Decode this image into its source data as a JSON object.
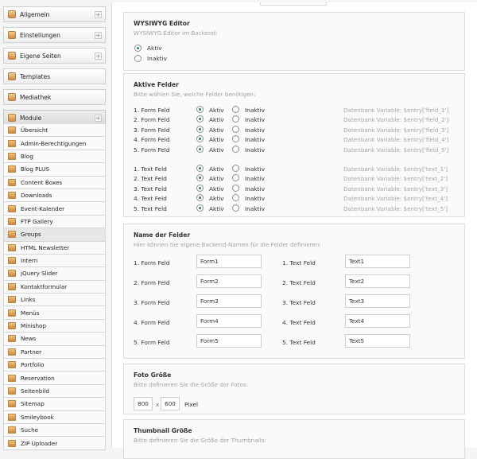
{
  "sidebar": {
    "top": [
      {
        "label": "Allgemein",
        "icon": "gear-icon"
      },
      {
        "label": "Einstellungen",
        "icon": "settings-icon"
      },
      {
        "label": "Eigene Seiten",
        "icon": "pages-icon"
      },
      {
        "label": "Templates",
        "icon": "templates-icon"
      },
      {
        "label": "Mediathek",
        "icon": "media-icon"
      }
    ],
    "module_header": "Module",
    "modules": [
      "Übersicht",
      "Admin-Berechtigungen",
      "Blog",
      "Blog PLUS",
      "Content Boxes",
      "Downloads",
      "Event-Kalender",
      "FTP Gallery",
      "Groups",
      "HTML Newsletter",
      "Intern",
      "jQuery Slider",
      "Kontaktformular",
      "Links",
      "Menüs",
      "Minishop",
      "News",
      "Partner",
      "Portfolio",
      "Reservation",
      "Seitenbild",
      "Sitemap",
      "Smileybook",
      "Suche",
      "ZIP Uploader"
    ],
    "highlighted_index": 8
  },
  "wysiwyg": {
    "title": "WYSIWYG Editor",
    "subtitle": "WYSIWYG Editor im Backend:",
    "opt_active": "Aktiv",
    "opt_inactive": "Inaktiv",
    "selected": "Aktiv"
  },
  "fields": {
    "title": "Aktive Felder",
    "subtitle": "Bitte wählen Sie, welche Felder benötigen:",
    "active_label": "Aktiv",
    "inactive_label": "Inaktiv",
    "form_rows": [
      {
        "label": "1. Form Feld",
        "db": "Datenbank Variable: $entry['field_1']",
        "active": true
      },
      {
        "label": "2. Form Feld",
        "db": "Datenbank Variable: $entry['field_2']",
        "active": true
      },
      {
        "label": "3. Form Feld",
        "db": "Datenbank Variable: $entry['field_3']",
        "active": true
      },
      {
        "label": "4. Form Feld",
        "db": "Datenbank Variable: $entry['field_4']",
        "active": true
      },
      {
        "label": "5. Form Feld",
        "db": "Datenbank Variable: $entry['field_5']",
        "active": true
      }
    ],
    "text_rows": [
      {
        "label": "1. Text Feld",
        "db": "Datenbank Variable: $entry['text_1']",
        "active": true
      },
      {
        "label": "2. Text Feld",
        "db": "Datenbank Variable: $entry['text_2']",
        "active": true
      },
      {
        "label": "3. Text Feld",
        "db": "Datenbank Variable: $entry['text_3']",
        "active": true
      },
      {
        "label": "4. Text Feld",
        "db": "Datenbank Variable: $entry['text_4']",
        "active": true
      },
      {
        "label": "5. Text Feld",
        "db": "Datenbank Variable: $entry['text_5']",
        "active": true
      }
    ]
  },
  "names": {
    "title": "Name der Felder",
    "subtitle": "Hier können Sie eigene Backend-Namen für die Felder definieren:",
    "rows": [
      {
        "form_label": "1. Form Feld",
        "form_value": "Form1",
        "text_label": "1. Text Feld",
        "text_value": "Text1"
      },
      {
        "form_label": "2. Form Feld",
        "form_value": "Form2",
        "text_label": "2. Text Feld",
        "text_value": "Text2"
      },
      {
        "form_label": "3. Form Feld",
        "form_value": "Form3",
        "text_label": "3. Text Feld",
        "text_value": "Text3"
      },
      {
        "form_label": "4. Form Feld",
        "form_value": "Form4",
        "text_label": "4. Text Feld",
        "text_value": "Text4"
      },
      {
        "form_label": "5. Form Feld",
        "form_value": "Form5",
        "text_label": "5. Text Feld",
        "text_value": "Text5"
      }
    ]
  },
  "photo": {
    "title": "Foto Größe",
    "subtitle": "Bitte definieren Sie die Größe der Fotos:",
    "width": "800",
    "sep": "x",
    "height": "600",
    "unit": "Pixel"
  },
  "thumb": {
    "title": "Thumbnail Größe",
    "subtitle": "Bitte definieren Sie die Größe der Thumbnails:"
  }
}
